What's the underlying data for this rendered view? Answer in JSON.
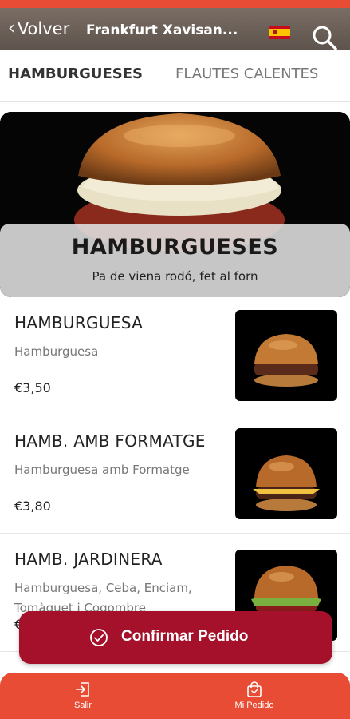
{
  "header": {
    "back_label": "Volver",
    "store_title": "Frankfurt Xavisan...",
    "flag_icon": "spain-flag-icon",
    "search_icon": "search-icon"
  },
  "tabs": [
    {
      "label": "HAMBURGUESES",
      "active": true
    },
    {
      "label": "FLAUTES CALENTES",
      "active": false
    }
  ],
  "hero": {
    "title": "HAMBURGUESES",
    "subtitle": "Pa de viena rodó, fet al forn"
  },
  "products": [
    {
      "name": "HAMBURGUESA",
      "description": "Hamburguesa",
      "price": "€3,50"
    },
    {
      "name": "HAMB. AMB FORMATGE",
      "description": "Hamburguesa amb Formatge",
      "price": "€3,80"
    },
    {
      "name": "HAMB. JARDINERA",
      "description": "Hamburguesa, Ceba, Enciam, Tomàquet i Cogombre",
      "price": "€"
    }
  ],
  "confirm": {
    "label": "Confirmar Pedido"
  },
  "bottom_nav": {
    "salir_label": "Salir",
    "pedido_label": "Mi Pedido"
  },
  "colors": {
    "accent": "#e84c34",
    "confirm_button": "#a5102b"
  }
}
